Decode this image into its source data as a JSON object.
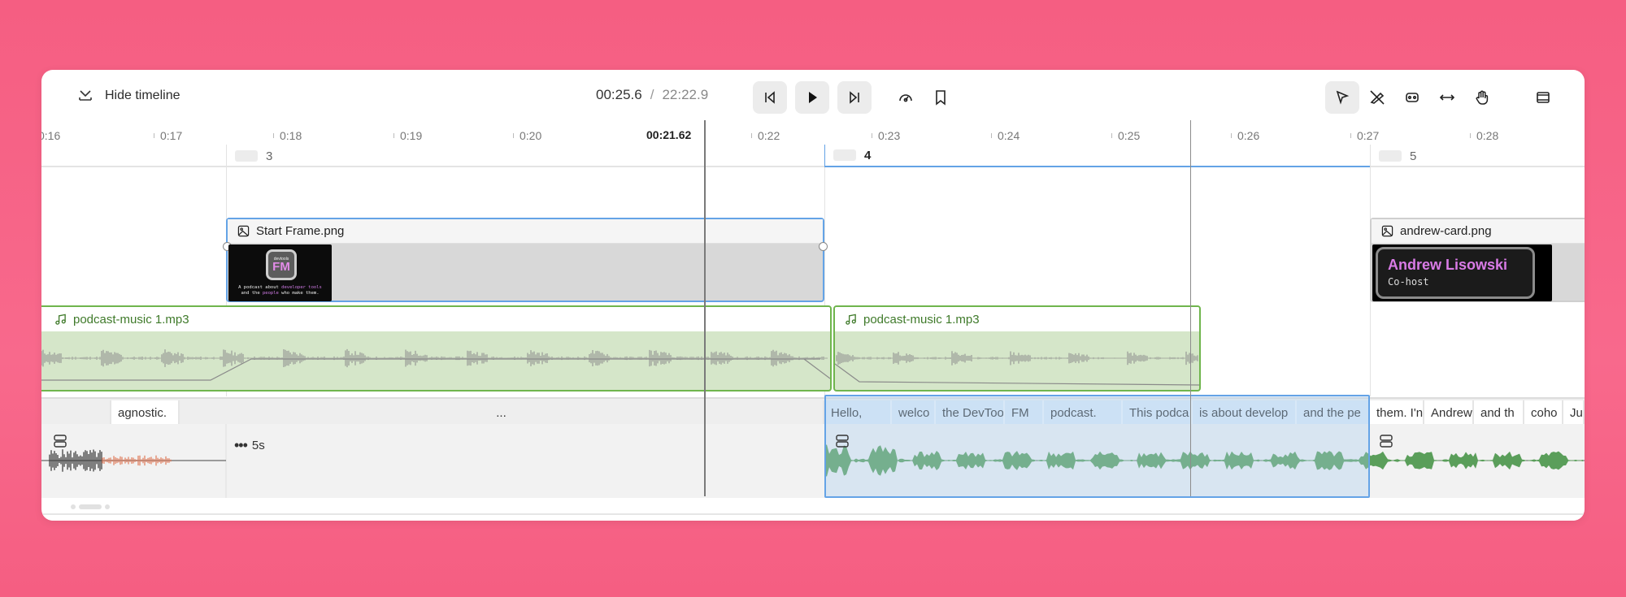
{
  "toolbar": {
    "hide_timeline_label": "Hide timeline",
    "current_time": "00:25.6",
    "time_separator": "/",
    "total_time": "22:22.9"
  },
  "ruler": {
    "ticks": [
      "0:16",
      "0:17",
      "0:18",
      "0:19",
      "0:20",
      "0:22",
      "0:23",
      "0:24",
      "0:25",
      "0:26",
      "0:27",
      "0:28"
    ],
    "playhead_label": "00:21.62"
  },
  "scenes": [
    {
      "label": "3"
    },
    {
      "label": "4"
    },
    {
      "label": "5"
    }
  ],
  "image_clips": [
    {
      "name": "Start Frame.png",
      "thumb_logo_small": "devtools",
      "thumb_logo": "FM",
      "thumb_tagline_1": "A podcast about",
      "thumb_tagline_hl_1": "developer tools",
      "thumb_tagline_2": "and the",
      "thumb_tagline_hl_2": "people",
      "thumb_tagline_3": "who make them."
    },
    {
      "name": "andrew-card.png",
      "card_name": "Andrew Lisowski",
      "card_role": "Co-host"
    }
  ],
  "audio_clips": [
    {
      "name": "podcast-music 1.mp3"
    },
    {
      "name": "podcast-music 1.mp3"
    }
  ],
  "transcript": {
    "words": [
      "agnostic.",
      "...",
      "Hello,",
      "welco",
      "the DevToo",
      "FM",
      "podcast.",
      "This podca",
      "is about develop",
      "and the pe",
      "them. I'n",
      "Andrew",
      "and th",
      "coho",
      "Jus"
    ],
    "gap_label": "5s"
  },
  "colors": {
    "background": "#f55e82",
    "selection": "#64a3e6",
    "audio": "#6fb54d",
    "playhead": "#7a7a7a"
  },
  "icons": [
    "hide-timeline-icon",
    "skip-back-icon",
    "play-icon",
    "skip-forward-icon",
    "speed-icon",
    "bookmark-icon",
    "pointer-icon",
    "razor-icon",
    "trim-icon",
    "stretch-icon",
    "hand-icon",
    "layout-icon",
    "image-icon",
    "music-note-icon",
    "speaker-row-icon"
  ]
}
